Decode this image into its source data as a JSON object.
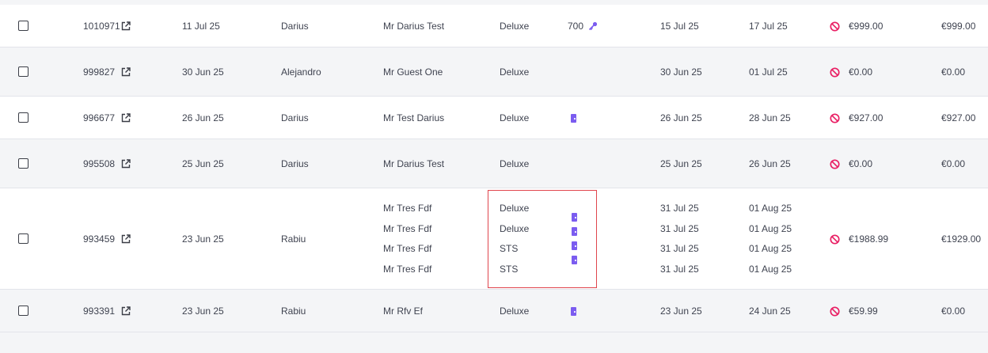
{
  "rows": [
    {
      "booking_id": "1010971",
      "created": "11 Jul 25",
      "agent": "Darius",
      "guests": [
        "Mr Darius Test"
      ],
      "rooms": [
        "Deluxe"
      ],
      "room_number": "700",
      "room_icons": [
        "key-icon"
      ],
      "arrivals": [
        "15 Jul 25"
      ],
      "departures": [
        "17 Jul 25"
      ],
      "amount": "€999.00",
      "balance": "€999.00"
    },
    {
      "booking_id": "999827",
      "created": "30 Jun 25",
      "agent": "Alejandro",
      "guests": [
        "Mr Guest One"
      ],
      "rooms": [
        "Deluxe"
      ],
      "room_number": "",
      "room_icons": [],
      "arrivals": [
        "30 Jun 25"
      ],
      "departures": [
        "01 Jul 25"
      ],
      "amount": "€0.00",
      "balance": "€0.00"
    },
    {
      "booking_id": "996677",
      "created": "26 Jun 25",
      "agent": "Darius",
      "guests": [
        "Mr Test Darius"
      ],
      "rooms": [
        "Deluxe"
      ],
      "room_number": "",
      "room_icons": [
        "door-icon"
      ],
      "arrivals": [
        "26 Jun 25"
      ],
      "departures": [
        "28 Jun 25"
      ],
      "amount": "€927.00",
      "balance": "€927.00"
    },
    {
      "booking_id": "995508",
      "created": "25 Jun 25",
      "agent": "Darius",
      "guests": [
        "Mr Darius Test"
      ],
      "rooms": [
        "Deluxe"
      ],
      "room_number": "",
      "room_icons": [],
      "arrivals": [
        "25 Jun 25"
      ],
      "departures": [
        "26 Jun 25"
      ],
      "amount": "€0.00",
      "balance": "€0.00"
    },
    {
      "booking_id": "993459",
      "created": "23 Jun 25",
      "agent": "Rabiu",
      "guests": [
        "Mr Tres Fdf",
        "Mr Tres Fdf",
        "Mr Tres Fdf",
        "Mr Tres Fdf"
      ],
      "rooms": [
        "Deluxe",
        "Deluxe",
        "STS",
        "STS"
      ],
      "room_number": "",
      "room_icons": [
        "door-icon",
        "door-icon",
        "door-icon",
        "door-icon"
      ],
      "arrivals": [
        "31 Jul 25",
        "31 Jul 25",
        "31 Jul 25",
        "31 Jul 25"
      ],
      "departures": [
        "01 Aug 25",
        "01 Aug 25",
        "01 Aug 25",
        "01 Aug 25"
      ],
      "amount": "€1988.99",
      "balance": "€1929.00"
    },
    {
      "booking_id": "993391",
      "created": "23 Jun 25",
      "agent": "Rabiu",
      "guests": [
        "Mr Rfv Ef"
      ],
      "rooms": [
        "Deluxe"
      ],
      "room_number": "",
      "room_icons": [
        "door-icon"
      ],
      "arrivals": [
        "23 Jun 25"
      ],
      "departures": [
        "24 Jun 25"
      ],
      "amount": "€59.99",
      "balance": "€0.00"
    }
  ],
  "icons": {
    "external_link": "external-link-icon",
    "no_show": "no-show-icon",
    "checkbox": "checkbox"
  },
  "colors": {
    "accent_purple": "#7b5cf0",
    "no_show_pink": "#e91e63",
    "highlight_red": "#e0454d",
    "row_alt": "#f4f5f7"
  }
}
